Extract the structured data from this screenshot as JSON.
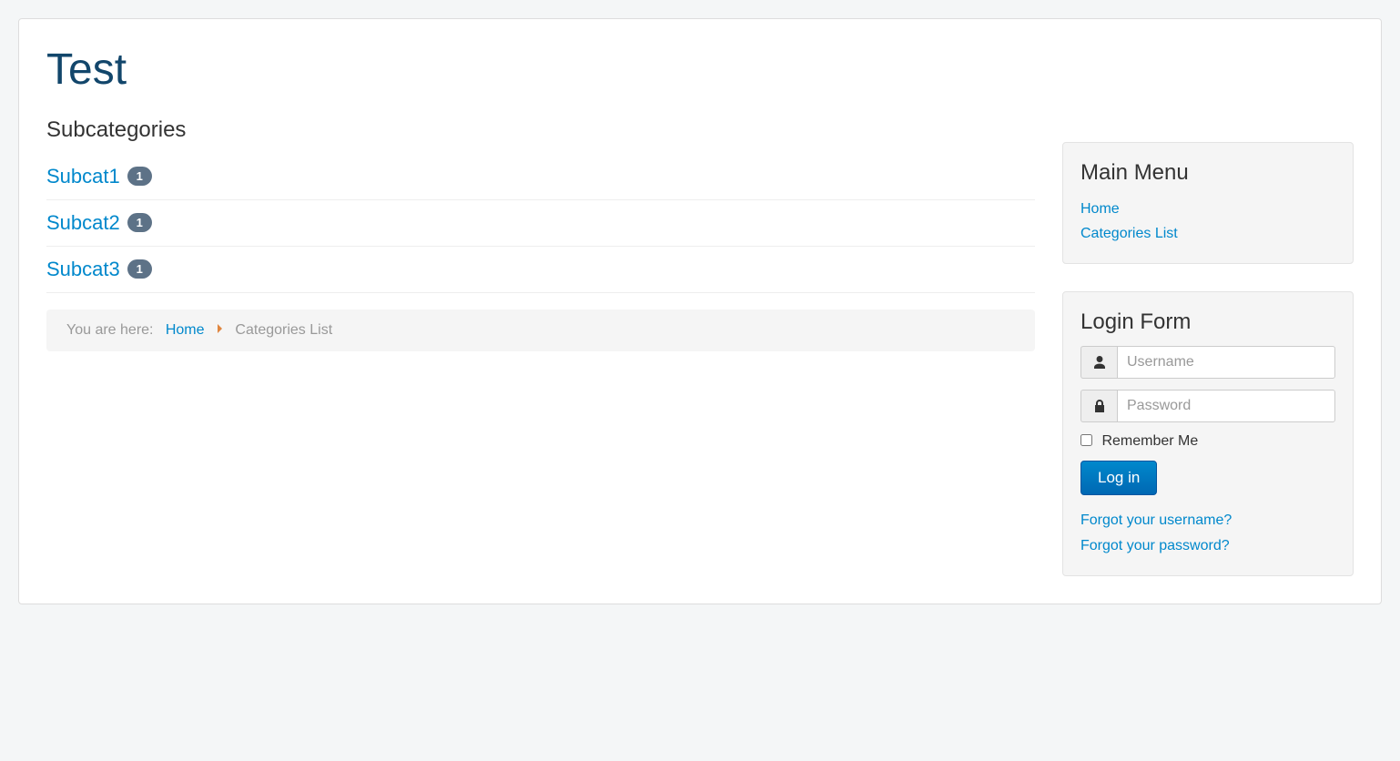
{
  "page": {
    "title": "Test"
  },
  "subcategories": {
    "heading": "Subcategories",
    "items": [
      {
        "label": "Subcat1",
        "count": "1"
      },
      {
        "label": "Subcat2",
        "count": "1"
      },
      {
        "label": "Subcat3",
        "count": "1"
      }
    ]
  },
  "breadcrumb": {
    "prefix": "You are here:",
    "home": "Home",
    "current": "Categories List"
  },
  "sidebar": {
    "main_menu": {
      "heading": "Main Menu",
      "items": [
        {
          "label": "Home"
        },
        {
          "label": "Categories List"
        }
      ]
    },
    "login": {
      "heading": "Login Form",
      "username_placeholder": "Username",
      "password_placeholder": "Password",
      "remember_label": "Remember Me",
      "submit_label": "Log in",
      "links": [
        {
          "label": "Forgot your username?"
        },
        {
          "label": "Forgot your password?"
        }
      ]
    }
  }
}
